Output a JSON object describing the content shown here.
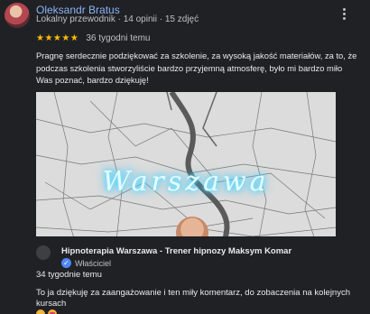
{
  "review": {
    "author": {
      "name": "Oleksandr Bratus",
      "meta": "Lokalny przewodnik · 14 opinii · 15 zdjęć"
    },
    "rating": {
      "stars": "★★★★★",
      "value": 5,
      "max": 5
    },
    "time": "36 tygodni temu",
    "text": "Pragnę serdecznie podziękować za szkolenie, za wysoką jakość materiałów, za to, że podczas szkolenia stworzyliście bardzo przyjemną atmosferę, było mi bardzo miło Was poznać, bardzo dziękuję!",
    "photo": {
      "neon_text": "Warszawa"
    }
  },
  "owner_reply": {
    "name": "Hipnoterapia Warszawa - Trener hipnozy Maksym Komar",
    "role": "Właściciel",
    "verified_icon": "✓",
    "time": "34 tygodnie temu",
    "text": "To ja dziękuję za zaangażowanie i ten miły komentarz, do zobaczenia na kolejnych kursach"
  },
  "colors": {
    "background": "#202124",
    "author_link": "#8ab4f8",
    "star": "#fbbc04",
    "verified": "#4f86f7"
  },
  "icons": {
    "more": "more-vert-icon",
    "verified": "verified-badge-icon",
    "emoji_1": "grinning-face-icon",
    "emoji_2": "heart-eyes-face-icon"
  }
}
